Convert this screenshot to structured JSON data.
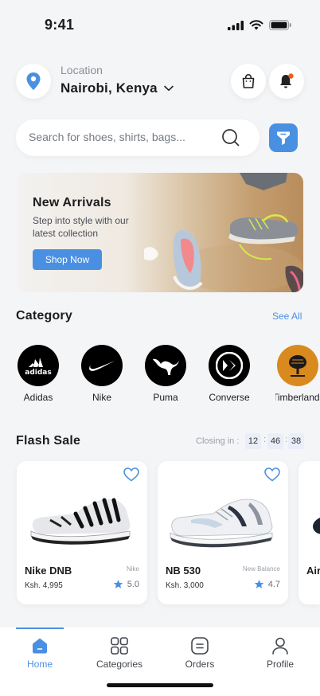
{
  "status_bar": {
    "time": "9:41"
  },
  "header": {
    "location_caption": "Location",
    "location_value": "Nairobi, Kenya"
  },
  "search": {
    "placeholder": "Search for shoes, shirts, bags..."
  },
  "banner": {
    "title": "New Arrivals",
    "subtitle": "Step into style with our latest collection",
    "button_label": "Shop Now"
  },
  "category": {
    "title": "Category",
    "see_all": "See All",
    "brands": [
      {
        "label": "Adidas"
      },
      {
        "label": "Nike"
      },
      {
        "label": "Puma"
      },
      {
        "label": "Converse"
      },
      {
        "label": "Timberland"
      }
    ]
  },
  "flash_sale": {
    "title": "Flash Sale",
    "closing_label": "Closing in :",
    "timer": {
      "hours": "12",
      "minutes": "46",
      "seconds": "38"
    },
    "products": [
      {
        "name": "Nike DNB",
        "brand": "Nike",
        "price": "Ksh. 4,995",
        "rating": "5.0"
      },
      {
        "name": "NB 530",
        "brand": "New Balance",
        "price": "Ksh. 3,000",
        "rating": "4.7"
      },
      {
        "name": "Air"
      }
    ]
  },
  "bottom_nav": {
    "items": [
      {
        "label": "Home"
      },
      {
        "label": "Categories"
      },
      {
        "label": "Orders"
      },
      {
        "label": "Profile"
      }
    ]
  },
  "colors": {
    "accent": "#4a90e2",
    "notification_dot": "#f05a28",
    "background": "#f4f5f7"
  },
  "icons": [
    "location-pin-icon",
    "chevron-down-icon",
    "shopping-bag-icon",
    "bell-icon",
    "search-icon",
    "filter-icon",
    "heart-icon",
    "star-icon",
    "home-icon",
    "grid-icon",
    "orders-icon",
    "profile-icon"
  ]
}
